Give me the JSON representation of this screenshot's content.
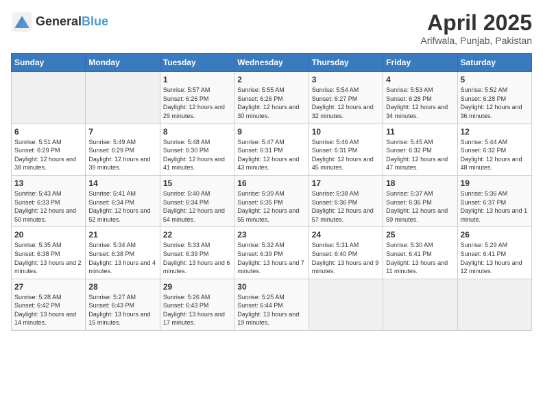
{
  "header": {
    "logo_line1": "General",
    "logo_line2": "Blue",
    "month": "April 2025",
    "location": "Arifwala, Punjab, Pakistan"
  },
  "weekdays": [
    "Sunday",
    "Monday",
    "Tuesday",
    "Wednesday",
    "Thursday",
    "Friday",
    "Saturday"
  ],
  "weeks": [
    [
      {
        "day": "",
        "info": ""
      },
      {
        "day": "",
        "info": ""
      },
      {
        "day": "1",
        "info": "Sunrise: 5:57 AM\nSunset: 6:26 PM\nDaylight: 12 hours and 29 minutes."
      },
      {
        "day": "2",
        "info": "Sunrise: 5:55 AM\nSunset: 6:26 PM\nDaylight: 12 hours and 30 minutes."
      },
      {
        "day": "3",
        "info": "Sunrise: 5:54 AM\nSunset: 6:27 PM\nDaylight: 12 hours and 32 minutes."
      },
      {
        "day": "4",
        "info": "Sunrise: 5:53 AM\nSunset: 6:28 PM\nDaylight: 12 hours and 34 minutes."
      },
      {
        "day": "5",
        "info": "Sunrise: 5:52 AM\nSunset: 6:28 PM\nDaylight: 12 hours and 36 minutes."
      }
    ],
    [
      {
        "day": "6",
        "info": "Sunrise: 5:51 AM\nSunset: 6:29 PM\nDaylight: 12 hours and 38 minutes."
      },
      {
        "day": "7",
        "info": "Sunrise: 5:49 AM\nSunset: 6:29 PM\nDaylight: 12 hours and 39 minutes."
      },
      {
        "day": "8",
        "info": "Sunrise: 5:48 AM\nSunset: 6:30 PM\nDaylight: 12 hours and 41 minutes."
      },
      {
        "day": "9",
        "info": "Sunrise: 5:47 AM\nSunset: 6:31 PM\nDaylight: 12 hours and 43 minutes."
      },
      {
        "day": "10",
        "info": "Sunrise: 5:46 AM\nSunset: 6:31 PM\nDaylight: 12 hours and 45 minutes."
      },
      {
        "day": "11",
        "info": "Sunrise: 5:45 AM\nSunset: 6:32 PM\nDaylight: 12 hours and 47 minutes."
      },
      {
        "day": "12",
        "info": "Sunrise: 5:44 AM\nSunset: 6:32 PM\nDaylight: 12 hours and 48 minutes."
      }
    ],
    [
      {
        "day": "13",
        "info": "Sunrise: 5:43 AM\nSunset: 6:33 PM\nDaylight: 12 hours and 50 minutes."
      },
      {
        "day": "14",
        "info": "Sunrise: 5:41 AM\nSunset: 6:34 PM\nDaylight: 12 hours and 52 minutes."
      },
      {
        "day": "15",
        "info": "Sunrise: 5:40 AM\nSunset: 6:34 PM\nDaylight: 12 hours and 54 minutes."
      },
      {
        "day": "16",
        "info": "Sunrise: 5:39 AM\nSunset: 6:35 PM\nDaylight: 12 hours and 55 minutes."
      },
      {
        "day": "17",
        "info": "Sunrise: 5:38 AM\nSunset: 6:36 PM\nDaylight: 12 hours and 57 minutes."
      },
      {
        "day": "18",
        "info": "Sunrise: 5:37 AM\nSunset: 6:36 PM\nDaylight: 12 hours and 59 minutes."
      },
      {
        "day": "19",
        "info": "Sunrise: 5:36 AM\nSunset: 6:37 PM\nDaylight: 13 hours and 1 minute."
      }
    ],
    [
      {
        "day": "20",
        "info": "Sunrise: 5:35 AM\nSunset: 6:38 PM\nDaylight: 13 hours and 2 minutes."
      },
      {
        "day": "21",
        "info": "Sunrise: 5:34 AM\nSunset: 6:38 PM\nDaylight: 13 hours and 4 minutes."
      },
      {
        "day": "22",
        "info": "Sunrise: 5:33 AM\nSunset: 6:39 PM\nDaylight: 13 hours and 6 minutes."
      },
      {
        "day": "23",
        "info": "Sunrise: 5:32 AM\nSunset: 6:39 PM\nDaylight: 13 hours and 7 minutes."
      },
      {
        "day": "24",
        "info": "Sunrise: 5:31 AM\nSunset: 6:40 PM\nDaylight: 13 hours and 9 minutes."
      },
      {
        "day": "25",
        "info": "Sunrise: 5:30 AM\nSunset: 6:41 PM\nDaylight: 13 hours and 11 minutes."
      },
      {
        "day": "26",
        "info": "Sunrise: 5:29 AM\nSunset: 6:41 PM\nDaylight: 13 hours and 12 minutes."
      }
    ],
    [
      {
        "day": "27",
        "info": "Sunrise: 5:28 AM\nSunset: 6:42 PM\nDaylight: 13 hours and 14 minutes."
      },
      {
        "day": "28",
        "info": "Sunrise: 5:27 AM\nSunset: 6:43 PM\nDaylight: 13 hours and 15 minutes."
      },
      {
        "day": "29",
        "info": "Sunrise: 5:26 AM\nSunset: 6:43 PM\nDaylight: 13 hours and 17 minutes."
      },
      {
        "day": "30",
        "info": "Sunrise: 5:25 AM\nSunset: 6:44 PM\nDaylight: 13 hours and 19 minutes."
      },
      {
        "day": "",
        "info": ""
      },
      {
        "day": "",
        "info": ""
      },
      {
        "day": "",
        "info": ""
      }
    ]
  ]
}
